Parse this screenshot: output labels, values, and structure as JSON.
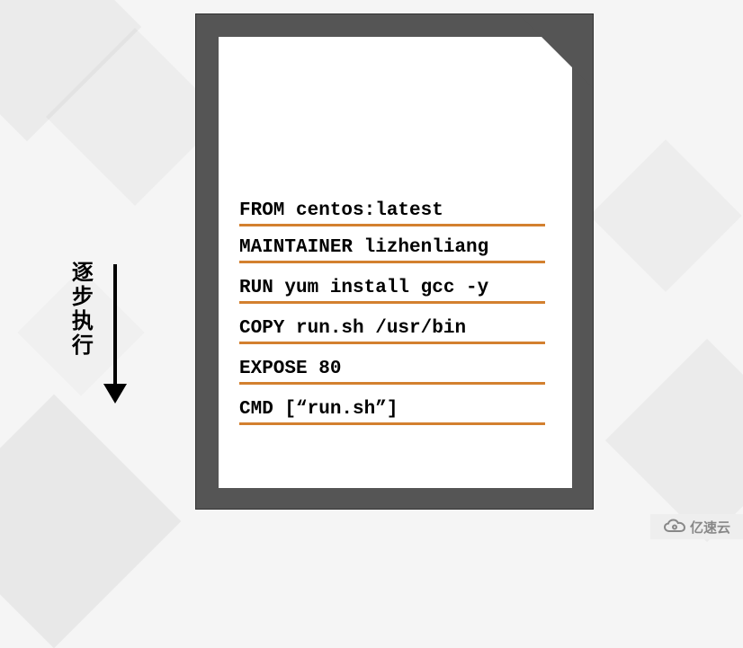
{
  "label": "逐步执行",
  "code": {
    "line1": "FROM centos:latest",
    "line2": "MAINTAINER lizhenliang",
    "line3": "RUN yum install gcc -y",
    "line4": "COPY run.sh /usr/bin",
    "line5": "EXPOSE 80",
    "line6": "CMD [“run.sh”]"
  },
  "watermark": "亿速云",
  "colors": {
    "document_border": "#555555",
    "underline": "#d3802f",
    "background": "#f5f5f5"
  }
}
